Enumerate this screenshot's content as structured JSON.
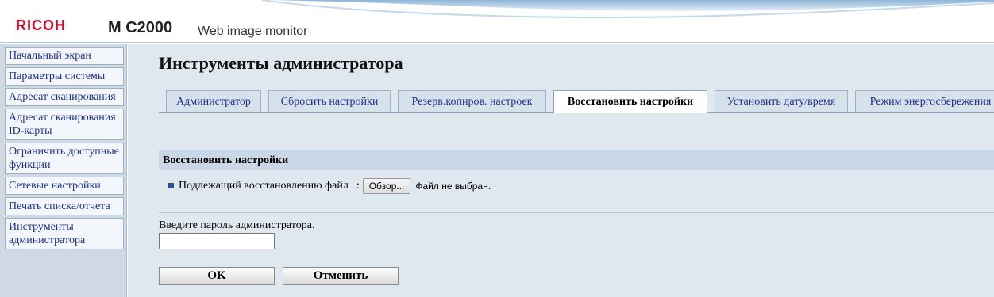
{
  "header": {
    "brand": "RICOH",
    "model": "M C2000",
    "subtitle": "Web image monitor"
  },
  "sidebar": {
    "items": [
      {
        "label": "Начальный экран"
      },
      {
        "label": "Параметры системы"
      },
      {
        "label": "Адресат сканирования"
      },
      {
        "label": "Адресат сканирования ID-карты"
      },
      {
        "label": "Ограничить доступные функции"
      },
      {
        "label": "Сетевые настройки"
      },
      {
        "label": "Печать списка/отчета"
      },
      {
        "label": "Инструменты администратора"
      }
    ]
  },
  "main": {
    "title": "Инструменты администратора",
    "tabs": [
      {
        "label": "Администратор",
        "active": false
      },
      {
        "label": "Сбросить настройки",
        "active": false
      },
      {
        "label": "Резерв.копиров. настроек",
        "active": false
      },
      {
        "label": "Восстановить настройки",
        "active": true
      },
      {
        "label": "Установить дату/время",
        "active": false
      },
      {
        "label": "Режим энергосбережения",
        "active": false
      }
    ],
    "section_title": "Восстановить настройки",
    "file_row": {
      "label": "Подлежащий восстановлению файл",
      "colon": ":",
      "browse_label": "Обзор...",
      "status": "Файл не выбран."
    },
    "password": {
      "label": "Введите пароль администратора.",
      "value": ""
    },
    "buttons": {
      "ok": "OK",
      "cancel": "Отменить"
    }
  },
  "colors": {
    "brand_red": "#c8102e",
    "link_blue": "#1c2f8c",
    "main_bg": "#dfe7ef",
    "sidebar_bg": "#cfd9e4",
    "section_bar": "#c9d7e6"
  }
}
